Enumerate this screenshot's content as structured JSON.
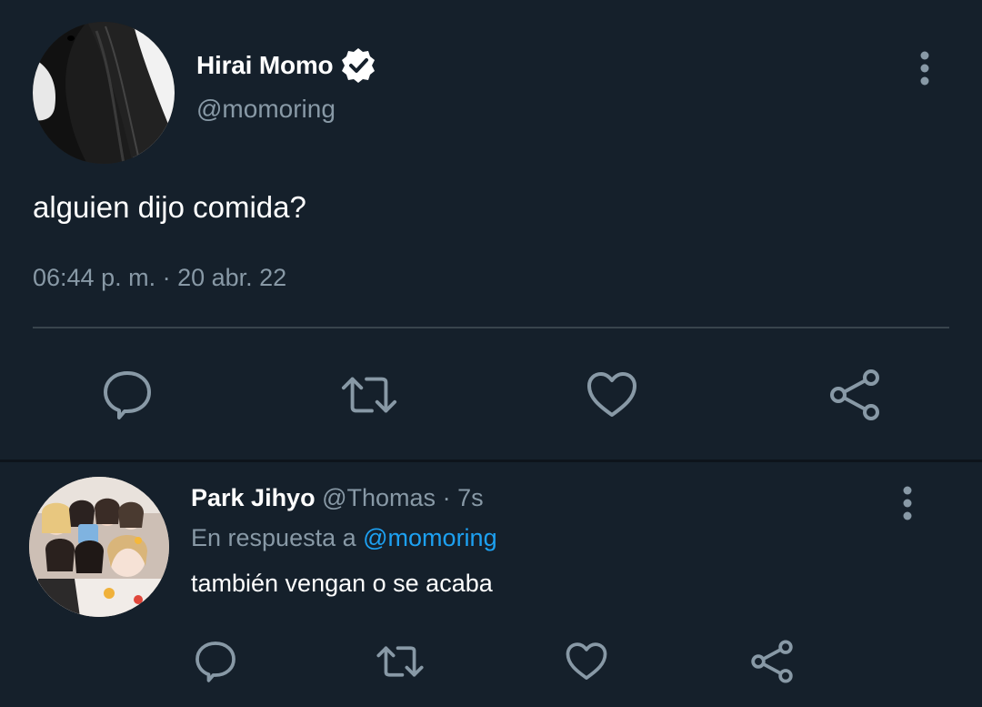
{
  "colors": {
    "background": "#15202b",
    "secondary_text": "#8899a6",
    "icon": "#8899a6",
    "divider": "#38444d",
    "link": "#1da1f2"
  },
  "main_tweet": {
    "author_name": "Hirai Momo",
    "author_handle": "@momoring",
    "verified": true,
    "text": "alguien dijo comida?",
    "meta": "06:44 p. m. · 20 abr. 22",
    "actions": [
      "reply-icon",
      "retweet-icon",
      "like-icon",
      "share-icon"
    ]
  },
  "reply_tweet": {
    "author_name": "Park Jihyo",
    "author_handle": "@Thomas",
    "separator": "·",
    "time": "7s",
    "reply_prefix": "En respuesta a",
    "reply_mention": "@momoring",
    "text": "también vengan o se acaba",
    "actions": [
      "reply-icon",
      "retweet-icon",
      "like-icon",
      "share-icon"
    ]
  }
}
